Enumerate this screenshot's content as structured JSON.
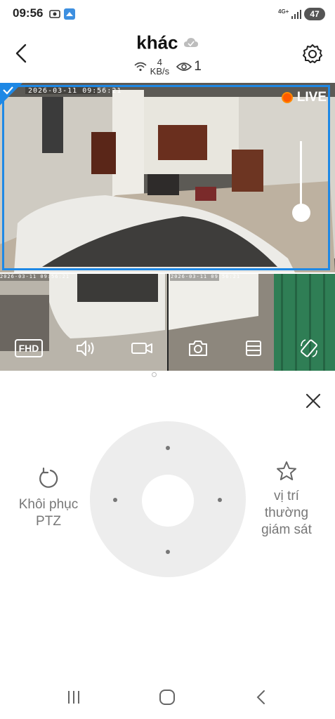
{
  "status_bar": {
    "time": "09:56",
    "network": "4G+",
    "battery": "47"
  },
  "header": {
    "title": "khác",
    "speed_value": "4",
    "speed_unit": "KB/s",
    "viewers": "1"
  },
  "video": {
    "live_label": "LIVE",
    "timestamps": [
      "2026-03-11 09:56:21",
      "2026-03-11 09:56:21",
      "2026-03-11 09:56:21"
    ],
    "toolbar": {
      "quality_label": "FHD"
    }
  },
  "ptz": {
    "reset_label": "Khôi phục PTZ",
    "preset_label": "vị trí thường giám sát"
  },
  "colors": {
    "accent": "#1e88e5",
    "live_dot": "#ff5a00"
  }
}
